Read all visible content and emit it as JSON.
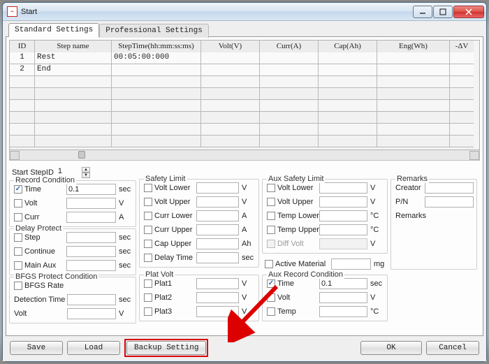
{
  "window": {
    "title": "Start"
  },
  "tabs": {
    "standard": "Standard Settings",
    "professional": "Professional Settings"
  },
  "grid": {
    "headers": {
      "id": "ID",
      "name": "Step name",
      "time": "StepTime(hh:mm:ss:ms)",
      "volt": "Volt(V)",
      "curr": "Curr(A)",
      "cap": "Cap(Ah)",
      "eng": "Eng(Wh)",
      "dv": "-ΔV"
    },
    "rows": [
      {
        "id": "1",
        "name": "Rest",
        "time": "00:05:00:000",
        "volt": "",
        "curr": "",
        "cap": "",
        "eng": "",
        "dv": ""
      },
      {
        "id": "2",
        "name": "End",
        "time": "",
        "volt": "",
        "curr": "",
        "cap": "",
        "eng": "",
        "dv": ""
      }
    ]
  },
  "start_step": {
    "label": "Start StepID",
    "value": "1"
  },
  "record_cond": {
    "title": "Record Condition",
    "time": {
      "label": "Time",
      "value": "0.1",
      "unit": "sec",
      "checked": true
    },
    "volt": {
      "label": "Volt",
      "value": "",
      "unit": "V",
      "checked": false
    },
    "curr": {
      "label": "Curr",
      "value": "",
      "unit": "A",
      "checked": false
    }
  },
  "delay_protect": {
    "title": "Delay Protect",
    "step": {
      "label": "Step",
      "value": "",
      "unit": "sec",
      "checked": false
    },
    "cont": {
      "label": "Continue",
      "value": "",
      "unit": "sec",
      "checked": false
    },
    "main": {
      "label": "Main Aux",
      "value": "",
      "unit": "sec",
      "checked": false
    }
  },
  "bfgs": {
    "title": "BFGS Protect Condition",
    "rate": {
      "label": "BFGS Rate",
      "checked": false
    },
    "detect": {
      "label": "Detection Time",
      "value": "",
      "unit": "sec"
    },
    "volt": {
      "label": "Volt",
      "value": "",
      "unit": "V"
    }
  },
  "safety": {
    "title": "Safety Limit",
    "vlower": {
      "label": "Volt Lower",
      "value": "",
      "unit": "V",
      "checked": false
    },
    "vupper": {
      "label": "Volt Upper",
      "value": "",
      "unit": "V",
      "checked": false
    },
    "clower": {
      "label": "Curr Lower",
      "value": "",
      "unit": "A",
      "checked": false
    },
    "cupper": {
      "label": "Curr Upper",
      "value": "",
      "unit": "A",
      "checked": false
    },
    "capupper": {
      "label": "Cap Upper",
      "value": "",
      "unit": "Ah",
      "checked": false
    },
    "delay": {
      "label": "Delay Time",
      "value": "",
      "unit": "sec",
      "checked": false
    }
  },
  "plat": {
    "title": "Plat Volt",
    "p1": {
      "label": "Plat1",
      "value": "",
      "unit": "V",
      "checked": false
    },
    "p2": {
      "label": "Plat2",
      "value": "",
      "unit": "V",
      "checked": false
    },
    "p3": {
      "label": "Plat3",
      "value": "",
      "unit": "V",
      "checked": false
    }
  },
  "aux_safety": {
    "title": "Aux Safety Limit",
    "vlower": {
      "label": "Volt Lower",
      "value": "",
      "unit": "V",
      "checked": false
    },
    "vupper": {
      "label": "Volt Upper",
      "value": "",
      "unit": "V",
      "checked": false
    },
    "tlower": {
      "label": "Temp Lower",
      "value": "",
      "unit": "°C",
      "checked": false
    },
    "tupper": {
      "label": "Temp Upper",
      "value": "",
      "unit": "°C",
      "checked": false
    },
    "dvolt": {
      "label": "Diff Volt",
      "value": "",
      "unit": "V",
      "checked": false,
      "disabled": true
    }
  },
  "active_mat": {
    "label": "Active Material",
    "value": "",
    "unit": "mg",
    "checked": false
  },
  "aux_record": {
    "title": "Aux Record Condition",
    "time": {
      "label": "Time",
      "value": "0.1",
      "unit": "sec",
      "checked": true
    },
    "volt": {
      "label": "Volt",
      "value": "",
      "unit": "V",
      "checked": false
    },
    "temp": {
      "label": "Temp",
      "value": "",
      "unit": "°C",
      "checked": false
    }
  },
  "remarks": {
    "title": "Remarks",
    "creator_lbl": "Creator",
    "creator_val": "",
    "pn_lbl": "P/N",
    "pn_val": "",
    "remarks_lbl": "Remarks"
  },
  "buttons": {
    "save": "Save",
    "load": "Load",
    "backup": "Backup Setting",
    "ok": "OK",
    "cancel": "Cancel"
  }
}
